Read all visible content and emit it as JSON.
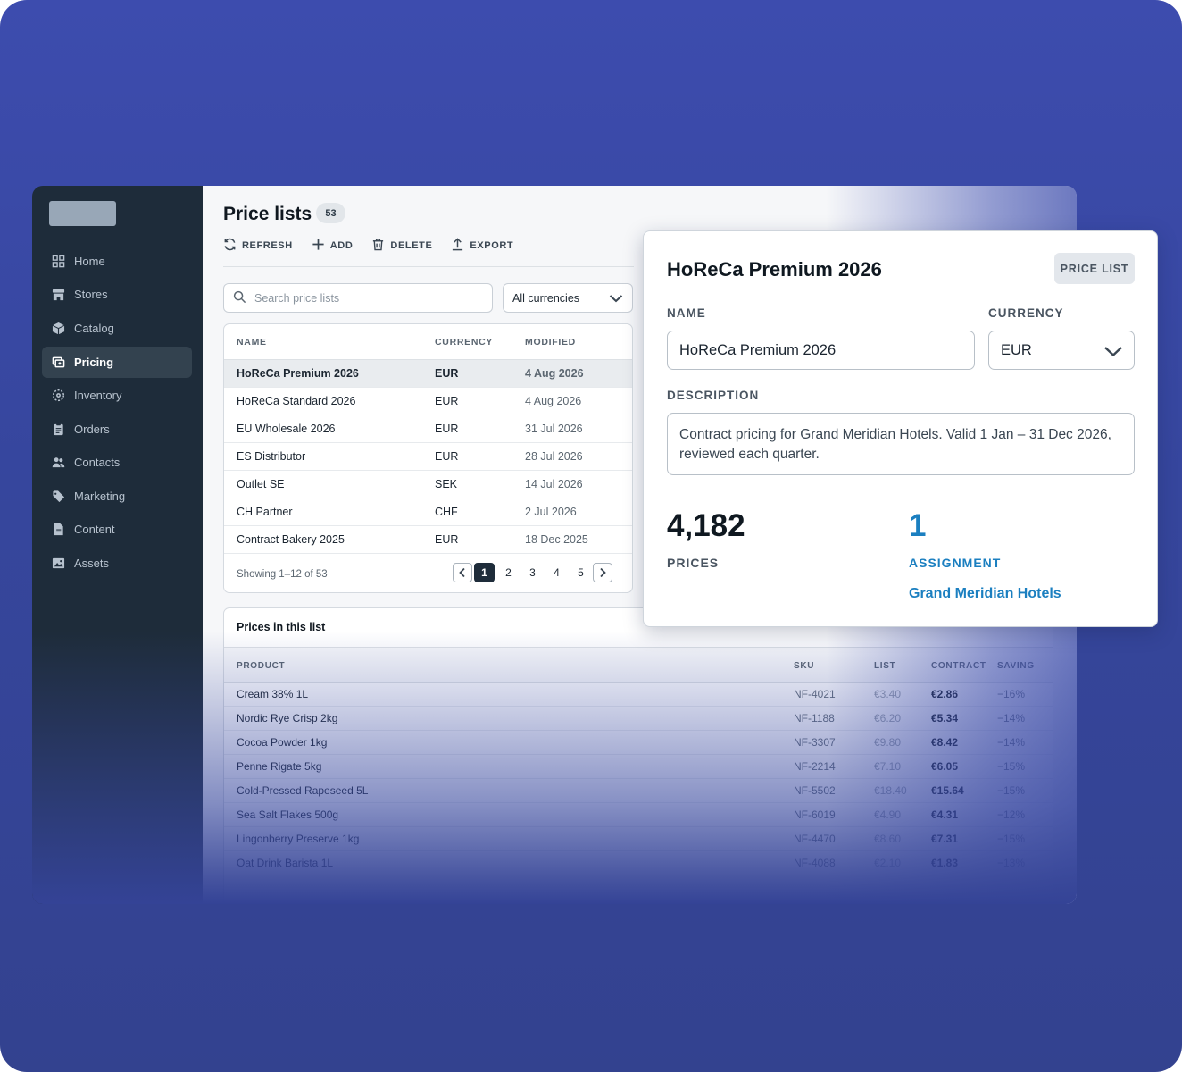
{
  "sidebar": {
    "items": [
      {
        "label": "Home",
        "icon": "grid-icon"
      },
      {
        "label": "Stores",
        "icon": "store-icon"
      },
      {
        "label": "Catalog",
        "icon": "cube-icon"
      },
      {
        "label": "Pricing",
        "icon": "price-tag-icon",
        "active": true
      },
      {
        "label": "Inventory",
        "icon": "inventory-icon"
      },
      {
        "label": "Orders",
        "icon": "clipboard-icon"
      },
      {
        "label": "Contacts",
        "icon": "people-icon"
      },
      {
        "label": "Marketing",
        "icon": "tag-icon"
      },
      {
        "label": "Content",
        "icon": "document-icon"
      },
      {
        "label": "Assets",
        "icon": "image-icon"
      }
    ]
  },
  "header": {
    "title": "Price lists",
    "count": "53"
  },
  "toolbar": {
    "refresh": "REFRESH",
    "add": "ADD",
    "delete": "DELETE",
    "export": "EXPORT"
  },
  "filters": {
    "search_placeholder": "Search price lists",
    "currency_value": "All currencies"
  },
  "price_lists": {
    "columns": [
      "NAME",
      "CURRENCY",
      "MODIFIED"
    ],
    "rows": [
      {
        "name": "HoReCa Premium 2026",
        "currency": "EUR",
        "modified": "4 Aug 2026",
        "selected": true
      },
      {
        "name": "HoReCa Standard 2026",
        "currency": "EUR",
        "modified": "4 Aug 2026"
      },
      {
        "name": "EU Wholesale 2026",
        "currency": "EUR",
        "modified": "31 Jul 2026"
      },
      {
        "name": "ES Distributor",
        "currency": "EUR",
        "modified": "28 Jul 2026"
      },
      {
        "name": "Outlet SE",
        "currency": "SEK",
        "modified": "14 Jul 2026"
      },
      {
        "name": "CH Partner",
        "currency": "CHF",
        "modified": "2 Jul 2026"
      },
      {
        "name": "Contract Bakery 2025",
        "currency": "EUR",
        "modified": "18 Dec 2025"
      }
    ],
    "showing": "Showing 1–12 of 53",
    "pages": [
      "1",
      "2",
      "3",
      "4",
      "5"
    ],
    "current_page": "1"
  },
  "prices": {
    "title": "Prices in this list",
    "columns": [
      "PRODUCT",
      "SKU",
      "LIST",
      "CONTRACT",
      "SAVING"
    ],
    "rows": [
      {
        "product": "Cream 38% 1L",
        "sku": "NF-4021",
        "list": "€3.40",
        "contract": "€2.86",
        "saving": "−16%"
      },
      {
        "product": "Nordic Rye Crisp 2kg",
        "sku": "NF-1188",
        "list": "€6.20",
        "contract": "€5.34",
        "saving": "−14%"
      },
      {
        "product": "Cocoa Powder 1kg",
        "sku": "NF-3307",
        "list": "€9.80",
        "contract": "€8.42",
        "saving": "−14%"
      },
      {
        "product": "Penne Rigate 5kg",
        "sku": "NF-2214",
        "list": "€7.10",
        "contract": "€6.05",
        "saving": "−15%"
      },
      {
        "product": "Cold-Pressed Rapeseed 5L",
        "sku": "NF-5502",
        "list": "€18.40",
        "contract": "€15.64",
        "saving": "−15%"
      },
      {
        "product": "Sea Salt Flakes 500g",
        "sku": "NF-6019",
        "list": "€4.90",
        "contract": "€4.31",
        "saving": "−12%"
      },
      {
        "product": "Lingonberry Preserve 1kg",
        "sku": "NF-4470",
        "list": "€8.60",
        "contract": "€7.31",
        "saving": "−15%"
      },
      {
        "product": "Oat Drink Barista 1L",
        "sku": "NF-4088",
        "list": "€2.10",
        "contract": "€1.83",
        "saving": "−13%"
      }
    ]
  },
  "detail": {
    "title": "HoReCa Premium 2026",
    "tag": "PRICE LIST",
    "name_label": "NAME",
    "name_value": "HoReCa Premium 2026",
    "currency_label": "CURRENCY",
    "currency_value": "EUR",
    "description_label": "DESCRIPTION",
    "description_value": "Contract pricing for Grand Meridian Hotels. Valid 1 Jan – 31 Dec 2026, reviewed each quarter.",
    "prices_count": "4,182",
    "prices_label": "PRICES",
    "assignment_count": "1",
    "assignment_label": "ASSIGNMENT",
    "assignment_link": "Grand Meridian Hotels"
  },
  "colors": {
    "backdrop": "#3d4cae",
    "sidebar": "#1e2c3a",
    "accent_link": "#1b7fc0"
  }
}
